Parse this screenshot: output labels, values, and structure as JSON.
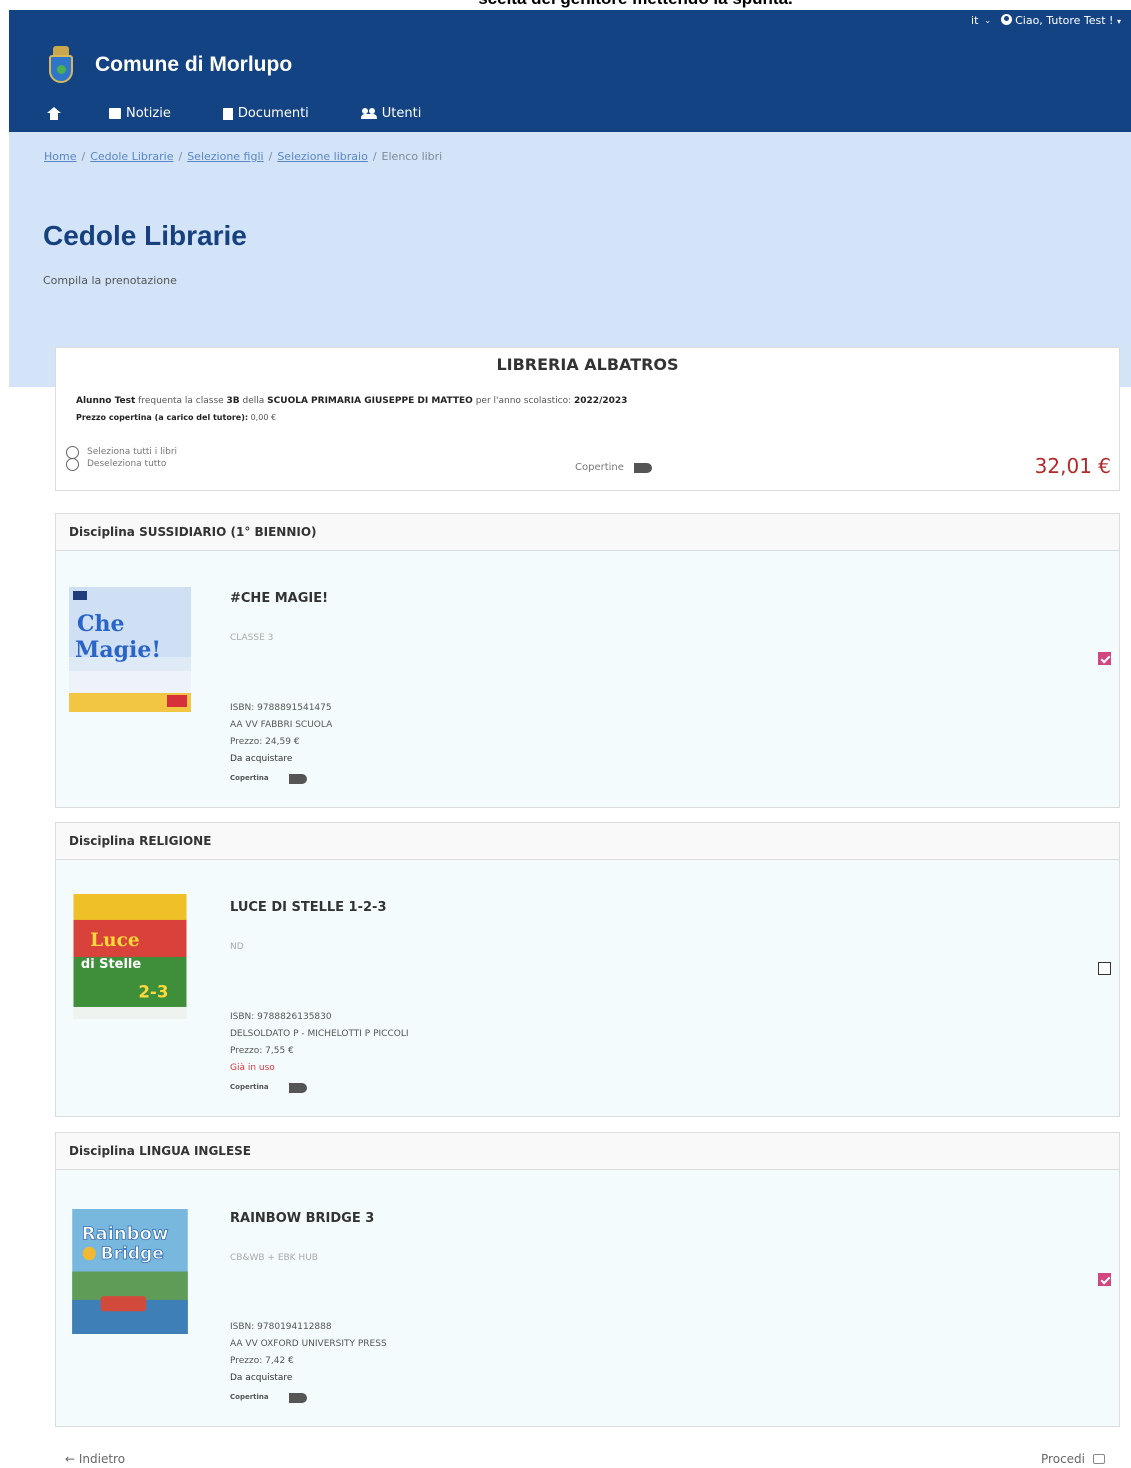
{
  "caption": "scelta del genitore mettendo la spunta.",
  "topbar": {
    "lang": "it",
    "user": "Ciao, Tutore Test !"
  },
  "brand": {
    "title": "Comune di Morlupo"
  },
  "nav": {
    "notizie": "Notizie",
    "documenti": "Documenti",
    "utenti": "Utenti"
  },
  "breadcrumb": {
    "home": "Home",
    "cedole": "Cedole Librarie",
    "figli": "Selezione figli",
    "libraio": "Selezione libraio",
    "current": "Elenco libri"
  },
  "page": {
    "title": "Cedole Librarie",
    "subtitle": "Compila la prenotazione"
  },
  "shop": {
    "name": "LIBRERIA ALBATROS",
    "student": "Alunno Test",
    "t1": " frequenta la classe ",
    "classe": "3B",
    "t2": " della ",
    "school": "SCUOLA PRIMARIA GIUSEPPE DI MATTEO",
    "t3": " per l'anno scolastico: ",
    "year": "2022/2023",
    "price_label": "Prezzo copertina (a carico del tutore):",
    "price_value": " 0,00 €",
    "select_all": "Seleziona tutti i libri",
    "deselect_all": "Deseleziona tutto",
    "covers_label": "Copertine",
    "total": "32,01 €"
  },
  "disciplines": [
    {
      "label": "Disciplina",
      "name": "SUSSIDIARIO (1° BIENNIO)",
      "book": {
        "title": "#CHE MAGIE!",
        "subtitle": "CLASSE 3",
        "isbn": "ISBN: 9788891541475",
        "author": "AA VV FABBRI SCUOLA",
        "price": "Prezzo: 24,59 €",
        "status": "Da acquistare",
        "cover_label": "Copertina",
        "checked": true
      }
    },
    {
      "label": "Disciplina",
      "name": "RELIGIONE",
      "book": {
        "title": "LUCE DI STELLE 1-2-3",
        "subtitle": "ND",
        "isbn": "ISBN: 9788826135830",
        "author": "DELSOLDATO P - MICHELOTTI P PICCOLI",
        "price": "Prezzo: 7,55 €",
        "status": "Già in uso",
        "cover_label": "Copertina",
        "checked": false
      }
    },
    {
      "label": "Disciplina",
      "name": "LINGUA INGLESE",
      "book": {
        "title": "RAINBOW BRIDGE 3",
        "subtitle": "CB&WB + EBK HUB",
        "isbn": "ISBN: 9780194112888",
        "author": "AA VV OXFORD UNIVERSITY PRESS",
        "price": "Prezzo: 7,42 €",
        "status": "Da acquistare",
        "cover_label": "Copertina",
        "checked": true
      }
    }
  ],
  "cover_art": {
    "che_magie": [
      "Che",
      "Magie!"
    ],
    "luce": [
      "Luce",
      "di Stelle",
      "2-3"
    ],
    "rainbow": [
      "Rainbow",
      "Bridge"
    ]
  },
  "footer": {
    "back": "← Indietro",
    "next": "Procedi"
  },
  "colors": {
    "header": "#134383",
    "hero": "#d3e4f9",
    "checkbox_checked": "#d2477f",
    "total": "#b22a2a",
    "used_status": "#d9363e"
  }
}
